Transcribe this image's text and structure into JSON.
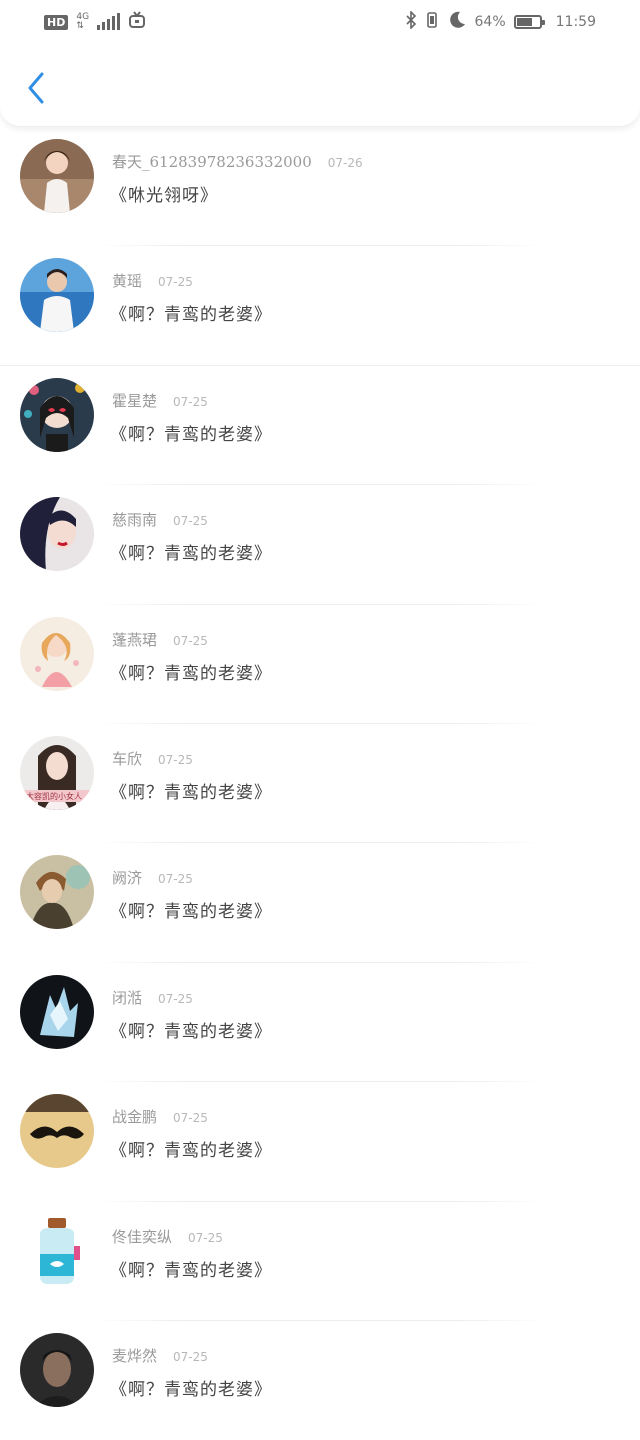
{
  "status_bar": {
    "hd": "HD",
    "network": "4G",
    "battery_percent": "64%",
    "time": "11:59",
    "battery_level": 0.64
  },
  "header": {
    "back_icon": "chevron-left-icon",
    "accent_color": "#2f8fe6"
  },
  "comments": [
    {
      "name": "春天_61283978236332000",
      "date": "07-26",
      "text": "《咻光翎呀》"
    },
    {
      "name": "黄瑶",
      "date": "07-25",
      "text": "《啊？青鸾的老婆》"
    },
    {
      "name": "霍星楚",
      "date": "07-25",
      "text": "《啊？青鸾的老婆》"
    },
    {
      "name": "慈雨南",
      "date": "07-25",
      "text": "《啊？青鸾的老婆》"
    },
    {
      "name": "蓬燕珺",
      "date": "07-25",
      "text": "《啊？青鸾的老婆》"
    },
    {
      "name": "车欣",
      "date": "07-25",
      "text": "《啊？青鸾的老婆》"
    },
    {
      "name": "阙济",
      "date": "07-25",
      "text": "《啊？青鸾的老婆》"
    },
    {
      "name": "闭湉",
      "date": "07-25",
      "text": "《啊？青鸾的老婆》"
    },
    {
      "name": "战金鹏",
      "date": "07-25",
      "text": "《啊？青鸾的老婆》"
    },
    {
      "name": "佟佳奕纵",
      "date": "07-25",
      "text": "《啊？青鸾的老婆》"
    },
    {
      "name": "麦烨然",
      "date": "07-25",
      "text": "《啊？青鸾的老婆》"
    }
  ],
  "avatar_badge_text": "大容凯的小女人"
}
